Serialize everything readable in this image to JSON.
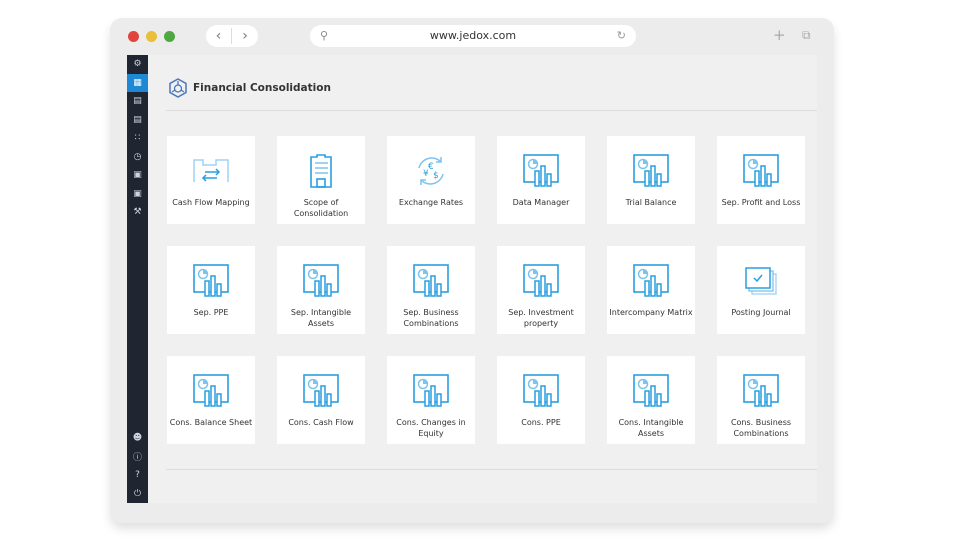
{
  "browser": {
    "url": "www.jedox.com",
    "colors": {
      "close": "#e0443e",
      "min": "#e9be3a",
      "max": "#4fa642"
    }
  },
  "sidebar": {
    "top": [
      "settings-icon",
      "dashboard-icon",
      "reports-icon",
      "table-icon",
      "model-icon",
      "timer-icon",
      "briefcase-icon",
      "toolbox-icon",
      "wrench-icon"
    ],
    "bottom": [
      "user-icon",
      "info-icon",
      "help-icon",
      "power-icon"
    ]
  },
  "header": {
    "title": "Financial Consolidation"
  },
  "accent": "#2a9fe0",
  "tiles": [
    {
      "label": "Cash Flow Mapping",
      "icon": "mapping"
    },
    {
      "label": "Scope of Consolidation",
      "icon": "building"
    },
    {
      "label": "Exchange Rates",
      "icon": "exchange"
    },
    {
      "label": "Data Manager",
      "icon": "chart"
    },
    {
      "label": "Trial Balance",
      "icon": "chart"
    },
    {
      "label": "Sep. Profit and Loss",
      "icon": "chart"
    },
    {
      "label": "Sep. PPE",
      "icon": "chart"
    },
    {
      "label": "Sep. Intangible Assets",
      "icon": "chart"
    },
    {
      "label": "Sep. Business Combinations",
      "icon": "chart"
    },
    {
      "label": "Sep. Investment property",
      "icon": "chart"
    },
    {
      "label": "Intercompany Matrix",
      "icon": "chart"
    },
    {
      "label": "Posting Journal",
      "icon": "journal"
    },
    {
      "label": "Cons. Balance Sheet",
      "icon": "chart"
    },
    {
      "label": "Cons. Cash Flow",
      "icon": "chart"
    },
    {
      "label": "Cons. Changes in Equity",
      "icon": "chart"
    },
    {
      "label": "Cons. PPE",
      "icon": "chart"
    },
    {
      "label": "Cons. Intangible Assets",
      "icon": "chart"
    },
    {
      "label": "Cons. Business Combinations",
      "icon": "chart"
    }
  ]
}
